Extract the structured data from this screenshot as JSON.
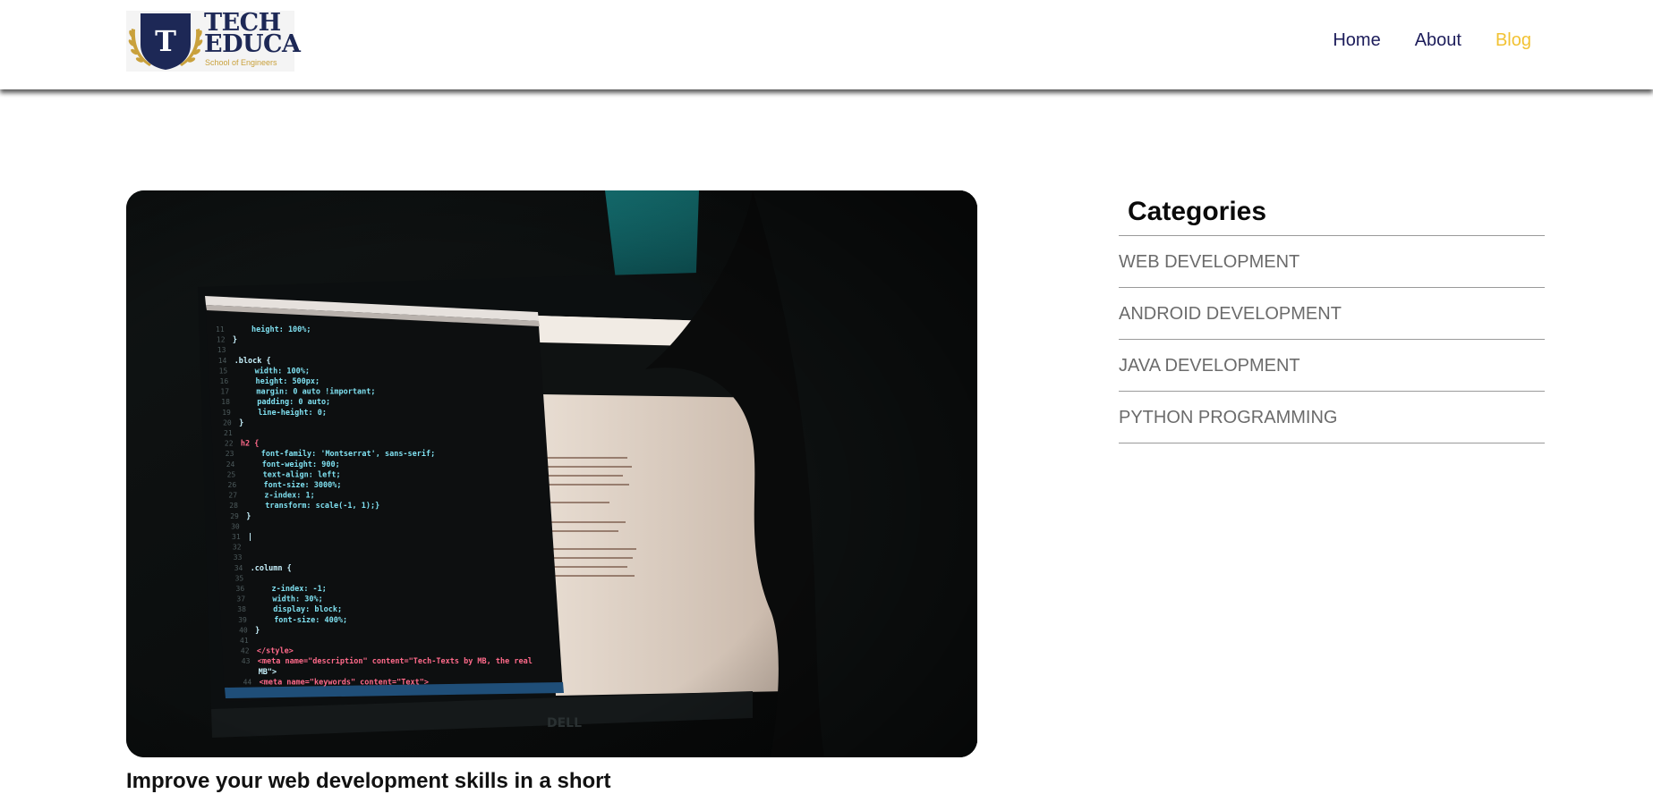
{
  "brand": {
    "logo_letter": "T",
    "title_line1": "TECH",
    "title_line2": "EDUCA",
    "tagline": "School of Engineers",
    "primary_color": "#1d2856",
    "gold_color": "#c9a13c"
  },
  "nav": {
    "items": [
      {
        "label": "Home",
        "active": false
      },
      {
        "label": "About",
        "active": false
      },
      {
        "label": "Blog",
        "active": true
      }
    ],
    "active_color": "#f2c233",
    "link_color": "#1d1d5b"
  },
  "post": {
    "image_alt": "Laptop screen showing CSS code in a dark room",
    "code_lines": [
      {
        "num": "11",
        "text": "height: 100%;"
      },
      {
        "num": "12",
        "text": "}"
      },
      {
        "num": "13",
        "text": ""
      },
      {
        "num": "14",
        "text": ".block {"
      },
      {
        "num": "15",
        "text": "width: 100%;"
      },
      {
        "num": "16",
        "text": "height: 500px;"
      },
      {
        "num": "17",
        "text": "margin: 0 auto !important;"
      },
      {
        "num": "18",
        "text": "padding: 0 auto;"
      },
      {
        "num": "19",
        "text": "line-height: 0;"
      },
      {
        "num": "20",
        "text": "}"
      },
      {
        "num": "21",
        "text": ""
      },
      {
        "num": "22",
        "text": "h2 {"
      },
      {
        "num": "23",
        "text": "font-family: 'Montserrat', sans-serif;"
      },
      {
        "num": "24",
        "text": "font-weight: 900;"
      },
      {
        "num": "25",
        "text": "text-align: left;"
      },
      {
        "num": "26",
        "text": "font-size: 3000%;"
      },
      {
        "num": "27",
        "text": "z-index: 1;"
      },
      {
        "num": "28",
        "text": "transform: scale(-1, 1);}"
      },
      {
        "num": "29",
        "text": "}"
      },
      {
        "num": "30",
        "text": ""
      },
      {
        "num": "31",
        "text": "|"
      },
      {
        "num": "32",
        "text": ""
      },
      {
        "num": "33",
        "text": ""
      },
      {
        "num": "34",
        "text": ".column {"
      },
      {
        "num": "35",
        "text": ""
      },
      {
        "num": "36",
        "text": "z-index: -1;"
      },
      {
        "num": "37",
        "text": "width: 30%;"
      },
      {
        "num": "38",
        "text": "display: block;"
      },
      {
        "num": "39",
        "text": "font-size: 400%;"
      },
      {
        "num": "40",
        "text": "}"
      },
      {
        "num": "41",
        "text": ""
      },
      {
        "num": "42",
        "text": "</style>"
      },
      {
        "num": "43",
        "text": "<meta name=\"description\" content=\"Tech-Texts by MB, the real"
      },
      {
        "num": "",
        "text": "MB\">"
      },
      {
        "num": "44",
        "text": "<meta name=\"keywords\" content=\"Text\">"
      }
    ],
    "title_partial": "Improve your web development skills in a short"
  },
  "sidebar": {
    "heading": "Categories",
    "categories": [
      "WEB DEVELOPMENT",
      "ANDROID DEVELOPMENT",
      "JAVA DEVELOPMENT",
      "PYTHON PROGRAMMING"
    ]
  }
}
